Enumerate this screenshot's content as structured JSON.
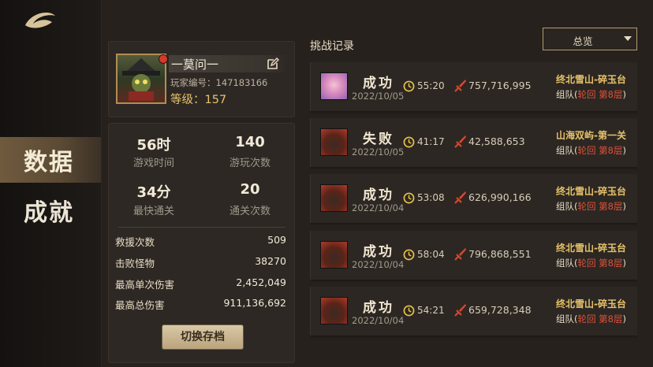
{
  "nav": {
    "items": [
      {
        "label": "数据",
        "active": true
      },
      {
        "label": "成就",
        "active": false
      }
    ]
  },
  "profile": {
    "name": "一莫问一",
    "id_text": "玩家编号：147183166",
    "level_text": "等级：157"
  },
  "stats": {
    "cells": [
      {
        "value": "56时",
        "label": "游戏时间"
      },
      {
        "value": "140",
        "label": "游玩次数"
      },
      {
        "value": "34分",
        "label": "最快通关"
      },
      {
        "value": "20",
        "label": "通关次数"
      }
    ],
    "rows": [
      {
        "label": "救援次数",
        "value": "509"
      },
      {
        "label": "击败怪物",
        "value": "38270"
      },
      {
        "label": "最高单次伤害",
        "value": "2,452,049"
      },
      {
        "label": "最高总伤害",
        "value": "911,136,692"
      }
    ],
    "switch_button": "切换存档"
  },
  "records": {
    "title": "挑战记录",
    "filter": "总览",
    "items": [
      {
        "avatar": "pink",
        "result": "成功",
        "date": "2022/10/05",
        "time": "55:20",
        "damage": "757,716,995",
        "stage": "终北雪山-碎玉台",
        "team_prefix": "组队(",
        "team_cycle": "轮回 第8层",
        "team_suffix": ")"
      },
      {
        "avatar": "red",
        "result": "失败",
        "date": "2022/10/05",
        "time": "41:17",
        "damage": "42,588,653",
        "stage": "山海双屿-第一关",
        "team_prefix": "组队(",
        "team_cycle": "轮回 第8层",
        "team_suffix": ")"
      },
      {
        "avatar": "red",
        "result": "成功",
        "date": "2022/10/04",
        "time": "53:08",
        "damage": "626,990,166",
        "stage": "终北雪山-碎玉台",
        "team_prefix": "组队(",
        "team_cycle": "轮回 第8层",
        "team_suffix": ")"
      },
      {
        "avatar": "red",
        "result": "成功",
        "date": "2022/10/04",
        "time": "58:04",
        "damage": "796,868,551",
        "stage": "终北雪山-碎玉台",
        "team_prefix": "组队(",
        "team_cycle": "轮回 第8层",
        "team_suffix": ")"
      },
      {
        "avatar": "red",
        "result": "成功",
        "date": "2022/10/04",
        "time": "54:21",
        "damage": "659,728,348",
        "stage": "终北雪山-碎玉台",
        "team_prefix": "组队(",
        "team_cycle": "轮回 第8层",
        "team_suffix": ")"
      }
    ]
  }
}
